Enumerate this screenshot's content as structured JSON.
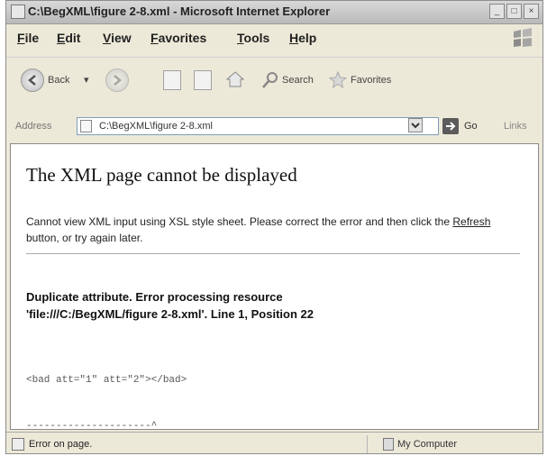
{
  "window": {
    "title": "C:\\BegXML\\figure 2-8.xml - Microsoft Internet Explorer"
  },
  "menu": {
    "items": [
      "File",
      "Edit",
      "View",
      "Favorites",
      "Tools",
      "Help"
    ]
  },
  "toolbar": {
    "back_label": "Back",
    "search_label": "Search",
    "favorites_label": "Favorites"
  },
  "address": {
    "label": "Address",
    "value": "C:\\BegXML\\figure 2-8.xml",
    "go_label": "Go",
    "links_label": "Links"
  },
  "content": {
    "heading": "The XML page cannot be displayed",
    "message_prefix": "Cannot view XML input using XSL style sheet. Please correct the error and then click the",
    "refresh_link": "Refresh",
    "message_suffix": "button, or try again later.",
    "error_line1": "Duplicate attribute. Error processing resource",
    "error_line2": "'file:///C:/BegXML/figure 2-8.xml'. Line 1, Position 22",
    "code_line": "<bad att=\"1\" att=\"2\"></bad>",
    "caret_line": "---------------------^"
  },
  "status": {
    "text": "Error on page.",
    "zone": "My Computer"
  }
}
